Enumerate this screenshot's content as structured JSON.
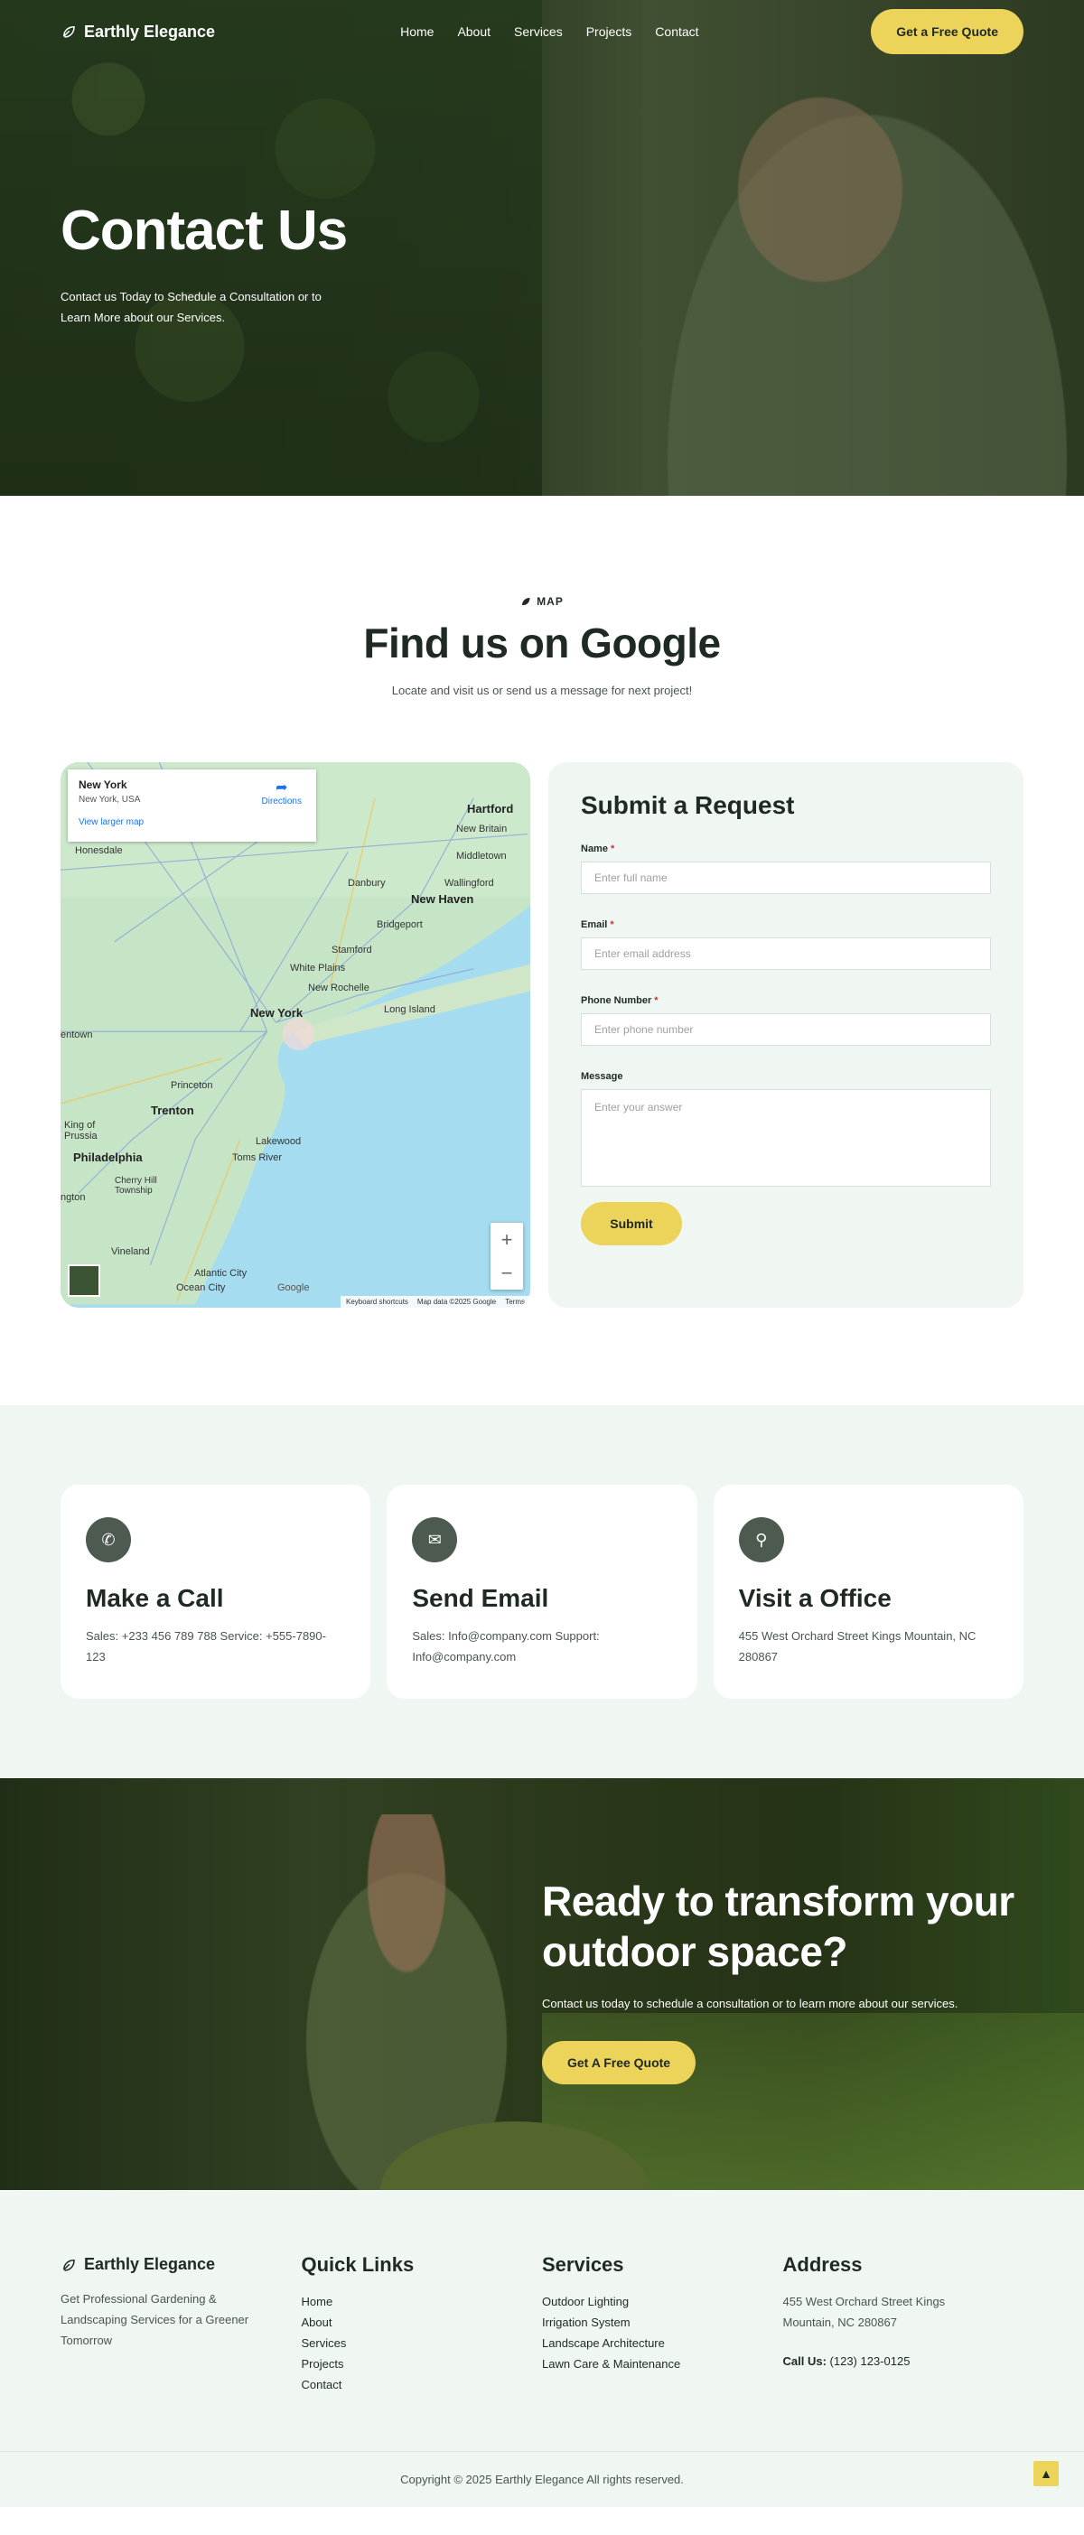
{
  "brand": {
    "name": "Earthly Elegance"
  },
  "nav": {
    "links": [
      "Home",
      "About",
      "Services",
      "Projects",
      "Contact"
    ],
    "quote_button": "Get a Free Quote"
  },
  "hero": {
    "title": "Contact Us",
    "subtitle": "Contact us Today to Schedule a Consultation or to Learn More about our Services."
  },
  "map_section": {
    "eyebrow": "MAP",
    "title": "Find us on Google",
    "subtitle": "Locate and visit us or send us a message for next project!",
    "map": {
      "place_title": "New York",
      "place_subtitle": "New York, USA",
      "larger_map_link": "View larger map",
      "directions_label": "Directions",
      "zoom_in": "+",
      "zoom_out": "−",
      "footer_shortcuts": "Keyboard shortcuts",
      "footer_data": "Map data ©2025 Google",
      "footer_terms": "Terms",
      "google": "Google",
      "labels": {
        "hartford": "Hartford",
        "new_britain": "New Britain",
        "middletown": "Middletown",
        "wallingford": "Wallingford",
        "new_haven": "New Haven",
        "danbury": "Danbury",
        "bridgeport": "Bridgeport",
        "stamford": "Stamford",
        "white_plains": "White Plains",
        "new_rochelle": "New Rochelle",
        "long_island": "Long Island",
        "new_york": "New York",
        "honesdale": "Honesdale",
        "princeton": "Princeton",
        "trenton": "Trenton",
        "philadelphia": "Philadelphia",
        "lakewood": "Lakewood",
        "toms_river": "Toms River",
        "cherry_hill": "Cherry Hill Township",
        "king_of_prussia": "King of Prussia",
        "vineland": "Vineland",
        "atlantic_city": "Atlantic City",
        "ocean_city": "Ocean City",
        "town": "entown",
        "ington": "ngton"
      }
    },
    "form": {
      "title": "Submit a Request",
      "name_label": "Name",
      "name_placeholder": "Enter full name",
      "email_label": "Email",
      "email_placeholder": "Enter email address",
      "phone_label": "Phone Number",
      "phone_placeholder": "Enter phone number",
      "message_label": "Message",
      "message_placeholder": "Enter your answer",
      "required_mark": "*",
      "submit": "Submit"
    }
  },
  "cards": [
    {
      "icon": "phone-icon",
      "glyph": "✆",
      "title": "Make a Call",
      "text": "Sales: +233 456 789 788 Service: +555-7890-123"
    },
    {
      "icon": "envelope-icon",
      "glyph": "✉",
      "title": "Send Email",
      "text": "Sales: Info@company.com Support: Info@company.com"
    },
    {
      "icon": "location-pin-icon",
      "glyph": "⚲",
      "title": "Visit a Office",
      "text": "455 West Orchard Street Kings Mountain, NC 280867"
    }
  ],
  "cta": {
    "title": "Ready to transform your outdoor space?",
    "text": "Contact us today to schedule a consultation or to learn more about our services.",
    "button": "Get A Free Quote"
  },
  "footer": {
    "description": "Get Professional Gardening & Landscaping Services for a Greener Tomorrow",
    "quick_links_title": "Quick Links",
    "quick_links": [
      "Home",
      "About",
      "Services",
      "Projects",
      "Contact"
    ],
    "services_title": "Services",
    "services": [
      "Outdoor Lighting",
      "Irrigation System",
      "Landscape Architecture",
      "Lawn Care & Maintenance"
    ],
    "address_title": "Address",
    "address": "455 West Orchard Street Kings Mountain, NC 280867",
    "call_label": "Call Us:",
    "call_number": "(123) 123-0125",
    "copyright": "Copyright © 2025 Earthly Elegance All rights reserved."
  },
  "colors": {
    "accent": "#ecd35a",
    "dark_green": "#4d5a50",
    "mint_bg": "#f0f6f2",
    "text_dark": "#1f2a24"
  }
}
